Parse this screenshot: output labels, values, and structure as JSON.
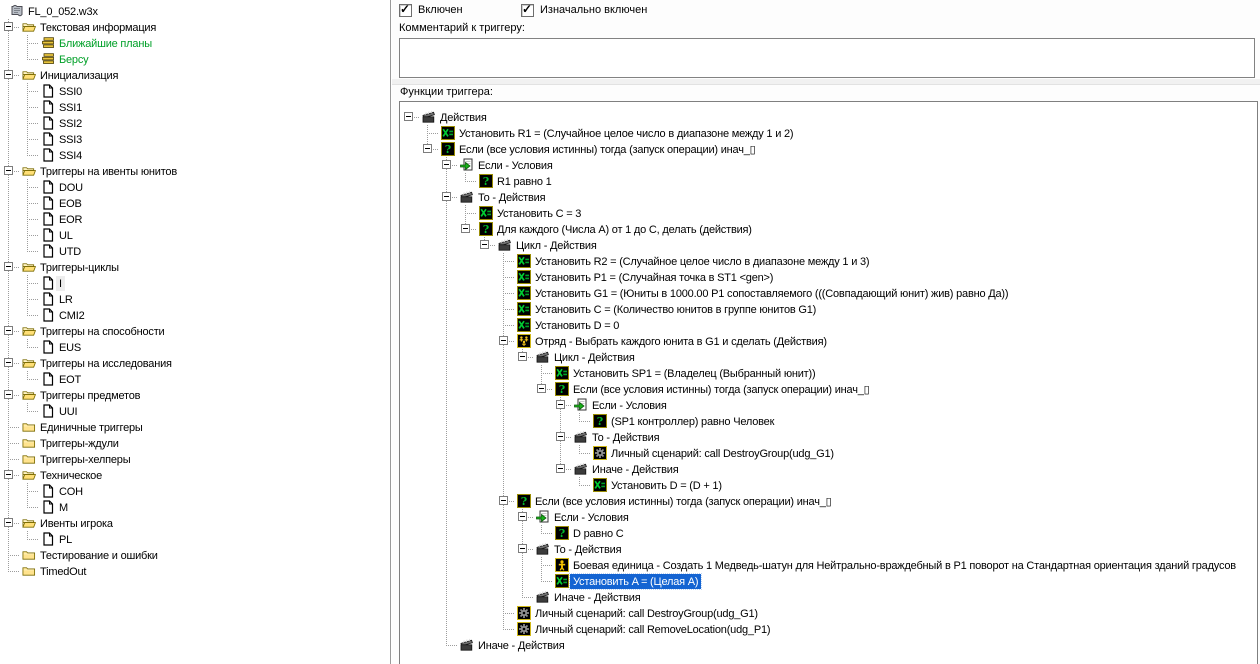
{
  "colors": {
    "selection_bg": "#1464d2",
    "selection_text": "#ffffff",
    "inactive_selection_bg": "#ededed",
    "text_trigger_green": "#00a028",
    "icon_border_olive": "#9a8d05",
    "icon_border_yellow": "#d0b818"
  },
  "labels": {
    "comment": "Комментарий к триггеру:",
    "functions": "Функции триггера:"
  },
  "checkboxes": [
    {
      "label": "Включен",
      "checked": true
    },
    {
      "label": "Изначально включен",
      "checked": true
    }
  ],
  "comment_value": "",
  "left_tree": {
    "root": {
      "label": "FL_0_052.w3x",
      "icon": "map-scroll",
      "children": [
        {
          "label": "Текстовая информация",
          "icon": "folder-open",
          "children": [
            {
              "label": "Ближайшие планы",
              "icon": "text-lines",
              "color": "green"
            },
            {
              "label": "Берсу",
              "icon": "text-lines",
              "color": "green"
            }
          ]
        },
        {
          "label": "Инициализация",
          "icon": "folder-open",
          "children": [
            {
              "label": "SSI0",
              "icon": "trigger-page"
            },
            {
              "label": "SSI1",
              "icon": "trigger-page"
            },
            {
              "label": "SSI2",
              "icon": "trigger-page"
            },
            {
              "label": "SSI3",
              "icon": "trigger-page"
            },
            {
              "label": "SSI4",
              "icon": "trigger-page"
            }
          ]
        },
        {
          "label": "Триггеры на ивенты юнитов",
          "icon": "folder-open",
          "children": [
            {
              "label": "DOU",
              "icon": "trigger-page"
            },
            {
              "label": "EOB",
              "icon": "trigger-page"
            },
            {
              "label": "EOR",
              "icon": "trigger-page"
            },
            {
              "label": "UL",
              "icon": "trigger-page"
            },
            {
              "label": "UTD",
              "icon": "trigger-page"
            }
          ]
        },
        {
          "label": "Триггеры-циклы",
          "icon": "folder-open",
          "children": [
            {
              "label": "I",
              "icon": "trigger-page",
              "selected": "inactive"
            },
            {
              "label": "LR",
              "icon": "trigger-page"
            },
            {
              "label": "CMI2",
              "icon": "trigger-page"
            }
          ]
        },
        {
          "label": "Триггеры на способности",
          "icon": "folder-open",
          "children": [
            {
              "label": "EUS",
              "icon": "trigger-page"
            }
          ]
        },
        {
          "label": "Триггеры на исследования",
          "icon": "folder-open",
          "children": [
            {
              "label": "EOT",
              "icon": "trigger-page"
            }
          ]
        },
        {
          "label": "Триггеры предметов",
          "icon": "folder-open",
          "children": [
            {
              "label": "UUI",
              "icon": "trigger-page"
            }
          ]
        },
        {
          "label": "Единичные триггеры",
          "icon": "folder-closed"
        },
        {
          "label": "Триггеры-ждули",
          "icon": "folder-closed"
        },
        {
          "label": "Триггеры-хелперы",
          "icon": "folder-closed"
        },
        {
          "label": "Техническое",
          "icon": "folder-open",
          "children": [
            {
              "label": "COH",
              "icon": "trigger-page"
            },
            {
              "label": "M",
              "icon": "trigger-page"
            }
          ]
        },
        {
          "label": "Ивенты игрока",
          "icon": "folder-open",
          "children": [
            {
              "label": "PL",
              "icon": "trigger-page"
            }
          ]
        },
        {
          "label": "Тестирование и ошибки",
          "icon": "folder-closed"
        },
        {
          "label": "TimedOut",
          "icon": "folder-closed"
        }
      ]
    }
  },
  "functions_tree": {
    "label": "Действия",
    "icon": "clapperboard",
    "children": [
      {
        "label": "Установить R1 = (Случайное целое число в диапазоне между 1 и 2)",
        "icon": "set-var"
      },
      {
        "label": "Если (все условия истинны) тогда (запуск операции) инач_▯",
        "icon": "if-question",
        "children": [
          {
            "label": "Если - Условия",
            "icon": "if-conditions",
            "children": [
              {
                "label": "R1 равно 1",
                "icon": "if-question"
              }
            ]
          },
          {
            "label": "То - Действия",
            "icon": "clapperboard",
            "children": [
              {
                "label": "Установить C = 3",
                "icon": "set-var"
              },
              {
                "label": "Для каждого (Числа A) от 1 до C, делать (действия)",
                "icon": "if-question",
                "children": [
                  {
                    "label": "Цикл - Действия",
                    "icon": "clapperboard",
                    "children": [
                      {
                        "label": "Установить R2 = (Случайное целое число в диапазоне между 1 и 3)",
                        "icon": "set-var"
                      },
                      {
                        "label": "Установить P1 = (Случайная точка в ST1 <gen>)",
                        "icon": "set-var"
                      },
                      {
                        "label": "Установить G1 = (Юниты в 1000.00 P1 сопоставляемого (((Совпадающий юнит) жив) равно Да))",
                        "icon": "set-var"
                      },
                      {
                        "label": "Установить C = (Количество юнитов в группе юнитов G1)",
                        "icon": "set-var"
                      },
                      {
                        "label": "Установить D = 0",
                        "icon": "set-var"
                      },
                      {
                        "label": "Отряд - Выбрать каждого юнита в G1 и сделать (Действия)",
                        "icon": "unit-group",
                        "children": [
                          {
                            "label": "Цикл - Действия",
                            "icon": "clapperboard",
                            "children": [
                              {
                                "label": "Установить SP1 = (Владелец (Выбранный юнит))",
                                "icon": "set-var"
                              },
                              {
                                "label": "Если (все условия истинны) тогда (запуск операции) инач_▯",
                                "icon": "if-question",
                                "children": [
                                  {
                                    "label": "Если - Условия",
                                    "icon": "if-conditions",
                                    "children": [
                                      {
                                        "label": "(SP1 контроллер) равно Человек",
                                        "icon": "if-question"
                                      }
                                    ]
                                  },
                                  {
                                    "label": "То - Действия",
                                    "icon": "clapperboard",
                                    "children": [
                                      {
                                        "label": "Личный сценарий: call DestroyGroup(udg_G1)",
                                        "icon": "custom-script"
                                      }
                                    ]
                                  },
                                  {
                                    "label": "Иначе - Действия",
                                    "icon": "clapperboard",
                                    "children": [
                                      {
                                        "label": "Установить D = (D + 1)",
                                        "icon": "set-var"
                                      }
                                    ]
                                  }
                                ]
                              }
                            ]
                          }
                        ]
                      },
                      {
                        "label": "Если (все условия истинны) тогда (запуск операции) инач_▯",
                        "icon": "if-question",
                        "children": [
                          {
                            "label": "Если - Условия",
                            "icon": "if-conditions",
                            "children": [
                              {
                                "label": "D равно C",
                                "icon": "if-question"
                              }
                            ]
                          },
                          {
                            "label": "То - Действия",
                            "icon": "clapperboard",
                            "children": [
                              {
                                "label": "Боевая единица - Создать 1 Медведь-шатун для Нейтрально-враждебный в P1 поворот на Стандартная ориентация зданий градусов",
                                "icon": "unit-create"
                              },
                              {
                                "label": "Установить A = (Целая A)",
                                "icon": "set-var",
                                "selected": "active"
                              }
                            ]
                          },
                          {
                            "label": "Иначе - Действия",
                            "icon": "clapperboard"
                          }
                        ]
                      },
                      {
                        "label": "Личный сценарий: call DestroyGroup(udg_G1)",
                        "icon": "custom-script"
                      },
                      {
                        "label": "Личный сценарий: call RemoveLocation(udg_P1)",
                        "icon": "custom-script"
                      }
                    ]
                  }
                ]
              }
            ]
          },
          {
            "label": "Иначе - Действия",
            "icon": "clapperboard"
          }
        ]
      }
    ]
  }
}
